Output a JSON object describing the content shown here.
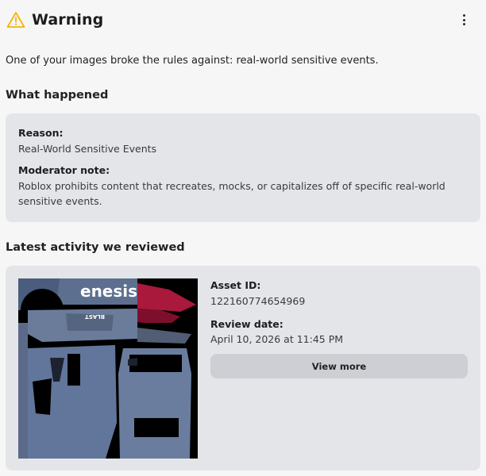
{
  "header": {
    "title": "Warning",
    "warning_icon": "warning-triangle-icon",
    "more_icon": "more-vertical-icon",
    "accent": "#f5b400"
  },
  "summary": "One of your images broke the rules against: real-world sensitive events.",
  "what_happened": {
    "heading": "What happened",
    "reason_label": "Reason:",
    "reason_value": "Real-World Sensitive Events",
    "note_label": "Moderator note:",
    "note_value": "Roblox prohibits content that recreates, mocks, or capitalizes off of specific real-world sensitive events."
  },
  "activity": {
    "heading": "Latest activity we reviewed",
    "thumbnail": {
      "brand_text": "enesis",
      "tag_text": "BLAST"
    },
    "asset_id_label": "Asset ID:",
    "asset_id_value": "122160774654969",
    "review_date_label": "Review date:",
    "review_date_value": "April 10, 2026 at 11:45 PM",
    "view_more_label": "View more"
  }
}
